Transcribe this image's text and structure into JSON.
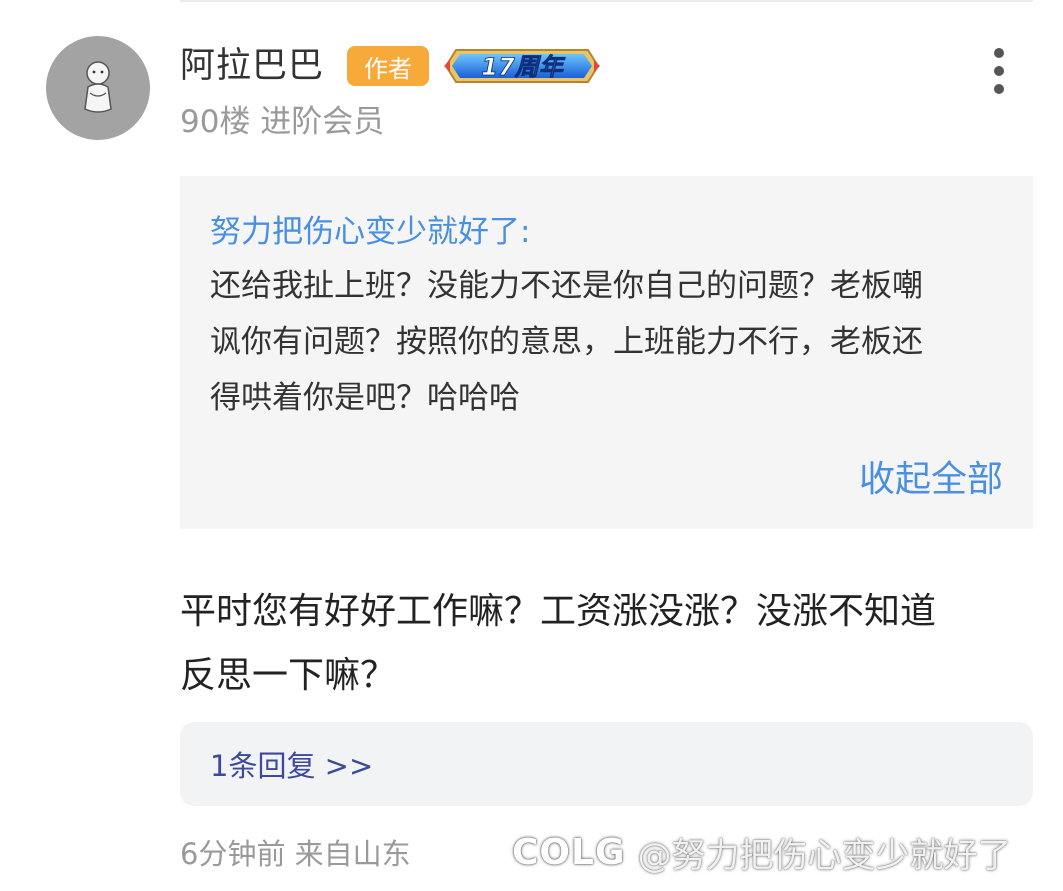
{
  "post": {
    "username": "阿拉巴巴",
    "author_badge": "作者",
    "anniversary_badge": "17周年",
    "meta": "90楼 进阶会员",
    "quote": {
      "author": "努力把伤心变少就好了:",
      "lines": [
        "还给我扯上班？没能力不还是你自己的问题？老板嘲",
        "讽你有问题？按照你的意思，上班能力不行，老板还",
        "得哄着你是吧？哈哈哈"
      ],
      "collapse_label": "收起全部"
    },
    "reply_lines": [
      "平时您有好好工作嘛？工资涨没涨？没涨不知道",
      "反思一下嘛？"
    ],
    "replies_link": "1条回复 >>",
    "timestamp": "6分钟前 来自山东"
  },
  "watermark": {
    "logo": "COLG",
    "text": "@努力把伤心变少就好了"
  },
  "colors": {
    "author_badge": "#f7a93a",
    "link_blue": "#4a90e2",
    "replies_text": "#3b4a9c",
    "meta_gray": "#9a9a9a"
  },
  "icons": [
    "avatar-figure-icon",
    "more-options-icon"
  ]
}
